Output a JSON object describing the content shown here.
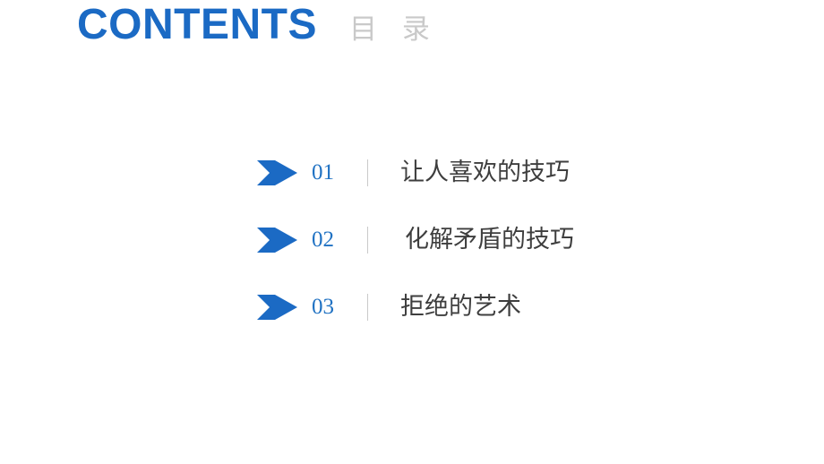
{
  "slide": {
    "background_color": "#FFFFFF",
    "accent_color": "#1B6AC4",
    "number_color": "#2072C3",
    "label_color": "#3E3E3E",
    "muted_color": "#C9C9C9"
  },
  "heading": {
    "english": "CONTENTS",
    "chinese": "目 录"
  },
  "contents": {
    "items": [
      {
        "number": "01",
        "label": "让人喜欢的技巧",
        "indent": false
      },
      {
        "number": "02",
        "label": "化解矛盾的技巧",
        "indent": true
      },
      {
        "number": "03",
        "label": "拒绝的艺术",
        "indent": false
      }
    ]
  }
}
